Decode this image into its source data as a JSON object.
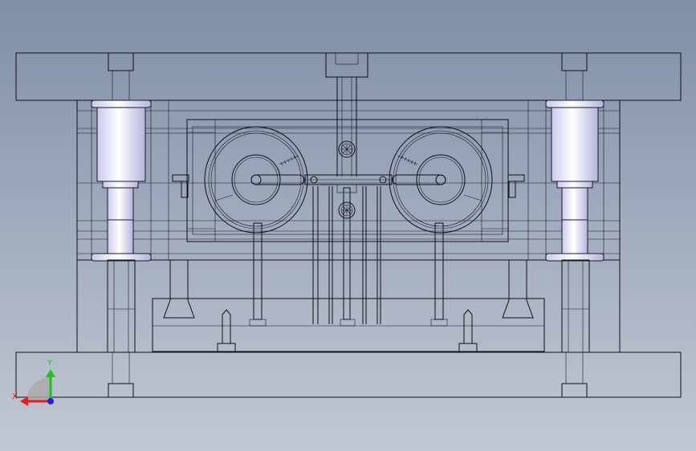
{
  "viewport": {
    "background_top": "#7f8ea6",
    "background_bottom": "#c2c8d3",
    "line_color": "#0f0f14"
  },
  "model": {
    "view": "front",
    "display_mode": "hidden-lines-visible"
  },
  "triad": {
    "x_label": "X",
    "y_label": "Y",
    "x_color": "#e02020",
    "y_color": "#20c020",
    "z_color": "#2020e0"
  }
}
